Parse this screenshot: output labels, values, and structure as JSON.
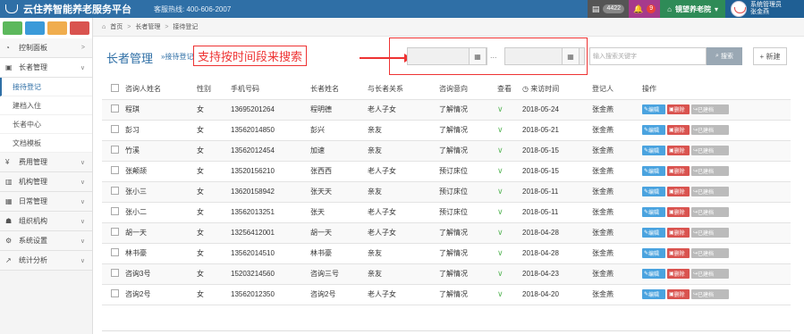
{
  "header": {
    "app_title": "云住养智能养老服务平台",
    "hotline": "客服热线: 400-606-2007",
    "message_count": "4422",
    "alert_count": "9",
    "org_name": "镜望养老院",
    "user_role": "系统管理员",
    "user_name": "张金燕"
  },
  "sidebar": {
    "items": [
      {
        "label": "控制面板",
        "icon": "dashboard-icon"
      },
      {
        "label": "长者管理",
        "icon": "user-icon"
      },
      {
        "label": "费用管理",
        "icon": "yen-icon"
      },
      {
        "label": "机构管理",
        "icon": "building-icon"
      },
      {
        "label": "日常管理",
        "icon": "calendar-icon"
      },
      {
        "label": "组织机构",
        "icon": "group-icon"
      },
      {
        "label": "系统设置",
        "icon": "gear-icon"
      },
      {
        "label": "统计分析",
        "icon": "chart-icon"
      }
    ],
    "sub_items": [
      "接待登记",
      "建档入住",
      "长者中心",
      "文档模板"
    ]
  },
  "breadcrumb": {
    "items": [
      "首页",
      "长者管理",
      "接待登记"
    ]
  },
  "page": {
    "title": "长者管理",
    "subtitle": "»接待登记",
    "annotation": "支持按时间段来搜索",
    "date_separator": "...",
    "search_placeholder": "输入搜索关键字",
    "search_label": "搜索",
    "new_label": "+ 新建"
  },
  "table": {
    "columns": [
      "咨询人姓名",
      "性别",
      "手机号码",
      "长者姓名",
      "与长者关系",
      "咨询意向",
      "查看",
      "来访时间",
      "登记人",
      "操作"
    ],
    "rows": [
      {
        "name": "程琪",
        "gender": "女",
        "phone": "13695201264",
        "elder": "程明德",
        "relation": "老人子女",
        "intent": "了解情况",
        "date": "2018-05-24",
        "registrar": "张金燕"
      },
      {
        "name": "彭习",
        "gender": "女",
        "phone": "13562014850",
        "elder": "彭兴",
        "relation": "亲友",
        "intent": "了解情况",
        "date": "2018-05-21",
        "registrar": "张金燕"
      },
      {
        "name": "竹溪",
        "gender": "女",
        "phone": "13562012454",
        "elder": "加速",
        "relation": "亲友",
        "intent": "了解情况",
        "date": "2018-05-15",
        "registrar": "张金燕"
      },
      {
        "name": "张颠颉",
        "gender": "女",
        "phone": "13520156210",
        "elder": "张西西",
        "relation": "老人子女",
        "intent": "预订床位",
        "date": "2018-05-15",
        "registrar": "张金燕"
      },
      {
        "name": "张小三",
        "gender": "女",
        "phone": "13620158942",
        "elder": "张天天",
        "relation": "亲友",
        "intent": "预订床位",
        "date": "2018-05-11",
        "registrar": "张金燕"
      },
      {
        "name": "张小二",
        "gender": "女",
        "phone": "13562013251",
        "elder": "张天",
        "relation": "老人子女",
        "intent": "预订床位",
        "date": "2018-05-11",
        "registrar": "张金燕"
      },
      {
        "name": "胡一天",
        "gender": "女",
        "phone": "13256412001",
        "elder": "胡一天",
        "relation": "老人子女",
        "intent": "了解情况",
        "date": "2018-04-28",
        "registrar": "张金燕"
      },
      {
        "name": "林书豪",
        "gender": "女",
        "phone": "13562014510",
        "elder": "林书豪",
        "relation": "亲友",
        "intent": "了解情况",
        "date": "2018-04-28",
        "registrar": "张金燕"
      },
      {
        "name": "咨询3号",
        "gender": "女",
        "phone": "15203214560",
        "elder": "咨询三号",
        "relation": "亲友",
        "intent": "了解情况",
        "date": "2018-04-23",
        "registrar": "张金燕"
      },
      {
        "name": "咨询2号",
        "gender": "女",
        "phone": "13562012350",
        "elder": "咨询2号",
        "relation": "老人子女",
        "intent": "了解情况",
        "date": "2018-04-20",
        "registrar": "张金燕"
      }
    ],
    "ops": {
      "edit": "编辑",
      "delete": "删除",
      "done": "已建档"
    }
  }
}
